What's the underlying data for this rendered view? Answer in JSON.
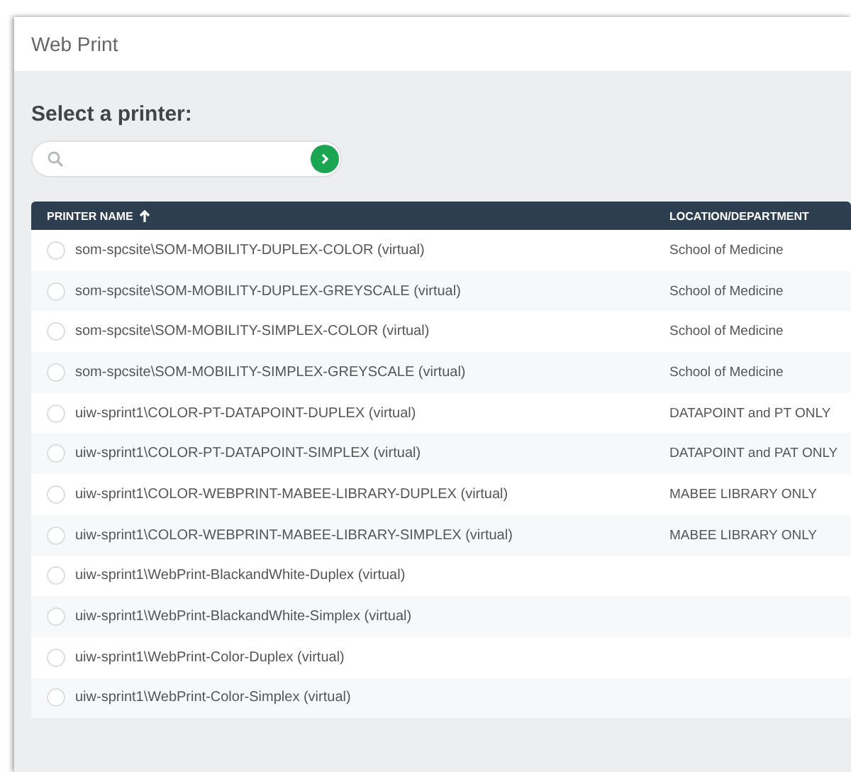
{
  "window": {
    "title": "Web Print"
  },
  "heading": "Select a printer:",
  "table": {
    "columns": [
      {
        "label": "PRINTER NAME",
        "sorted": true
      },
      {
        "label": "LOCATION/DEPARTMENT",
        "sorted": false
      }
    ],
    "rows": [
      {
        "name": "som-spcsite\\SOM-MOBILITY-DUPLEX-COLOR (virtual)",
        "location": "School of Medicine",
        "selected": false
      },
      {
        "name": "som-spcsite\\SOM-MOBILITY-DUPLEX-GREYSCALE (virtual)",
        "location": "School of Medicine",
        "selected": false
      },
      {
        "name": "som-spcsite\\SOM-MOBILITY-SIMPLEX-COLOR (virtual)",
        "location": "School of Medicine",
        "selected": false
      },
      {
        "name": "som-spcsite\\SOM-MOBILITY-SIMPLEX-GREYSCALE (virtual)",
        "location": "School of Medicine",
        "selected": false
      },
      {
        "name": "uiw-sprint1\\COLOR-PT-DATAPOINT-DUPLEX (virtual)",
        "location": "DATAPOINT and PT ONLY",
        "selected": false
      },
      {
        "name": "uiw-sprint1\\COLOR-PT-DATAPOINT-SIMPLEX (virtual)",
        "location": "DATAPOINT and PAT ONLY",
        "selected": false
      },
      {
        "name": "uiw-sprint1\\COLOR-WEBPRINT-MABEE-LIBRARY-DUPLEX (virtual)",
        "location": "MABEE LIBRARY ONLY",
        "selected": false
      },
      {
        "name": "uiw-sprint1\\COLOR-WEBPRINT-MABEE-LIBRARY-SIMPLEX (virtual)",
        "location": "MABEE LIBRARY ONLY",
        "selected": false
      },
      {
        "name": "uiw-sprint1\\WebPrint-BlackandWhite-Duplex (virtual)",
        "selected": false
      },
      {
        "name": "uiw-sprint1\\WebPrint-BlackandWhite-Simplex (virtual)",
        "selected": false
      },
      {
        "name": "uiw-sprint1\\WebPrint-Color-Duplex (virtual)",
        "selected": false
      },
      {
        "name": "uiw-sprint1\\WebPrint-Color-Simplex (virtual)",
        "selected": false
      }
    ]
  }
}
